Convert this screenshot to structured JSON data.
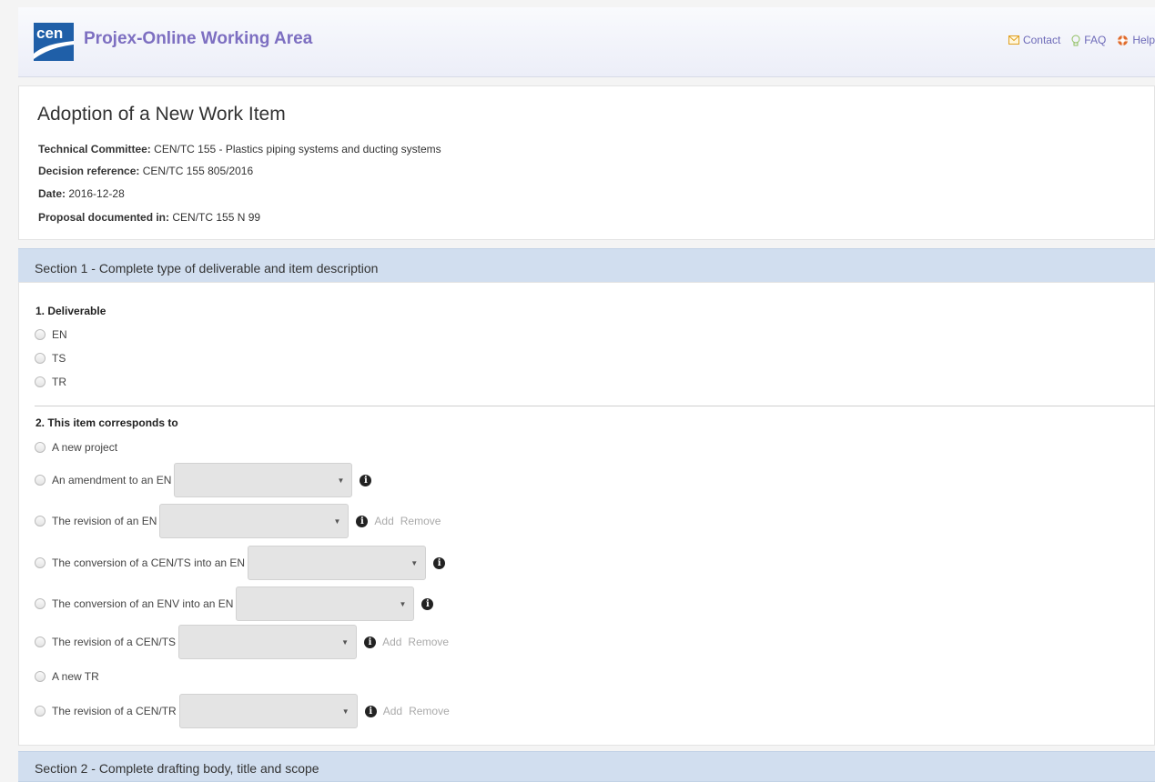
{
  "app": {
    "title": "Projex-Online Working Area",
    "logo_icon": "cen-logo-icon",
    "links": [
      {
        "label": "Contact",
        "icon": "envelope-icon"
      },
      {
        "label": "FAQ",
        "icon": "lightbulb-icon"
      },
      {
        "label": "Help",
        "icon": "lifebuoy-icon"
      }
    ]
  },
  "header": {
    "title": "Adoption of a New Work Item",
    "fields": [
      {
        "label": "Technical Committee:",
        "value": "CEN/TC 155 - Plastics piping systems and ducting systems"
      },
      {
        "label": "Decision reference:",
        "value": "CEN/TC 155 805/2016"
      },
      {
        "label": "Date:",
        "value": "2016-12-28"
      },
      {
        "label": "Proposal documented in:",
        "value": "CEN/TC 155 N 99"
      }
    ]
  },
  "section1": {
    "title": "Section 1 - Complete type of deliverable and item description",
    "q1": {
      "label": "1. Deliverable",
      "options": [
        "EN",
        "TS",
        "TR"
      ]
    },
    "q2": {
      "label": "2. This item corresponds to",
      "options": [
        {
          "label": "A new project"
        },
        {
          "label": "An amendment to an EN",
          "select_value": "",
          "info": "i"
        },
        {
          "label": "The revision of an EN",
          "select_value": "",
          "info": "i",
          "add": "Add",
          "remove": "Remove"
        },
        {
          "label": "The conversion of a CEN/TS into an EN",
          "select_value": "",
          "info": "i"
        },
        {
          "label": "The conversion of an ENV into an EN",
          "select_value": "",
          "info": "i"
        },
        {
          "label": "The revision of a CEN/TS",
          "select_value": "",
          "info": "i",
          "add": "Add",
          "remove": "Remove"
        },
        {
          "label": "A new TR"
        },
        {
          "label": "The revision of a CEN/TR",
          "select_value": "",
          "info": "i",
          "add": "Add",
          "remove": "Remove"
        }
      ]
    }
  },
  "section2": {
    "title": "Section 2 - Complete drafting body, title and scope"
  },
  "colors": {
    "title_purple": "#7d6fc1",
    "section_bar": "#d1deef",
    "logo_blue": "#1f5fa8"
  }
}
